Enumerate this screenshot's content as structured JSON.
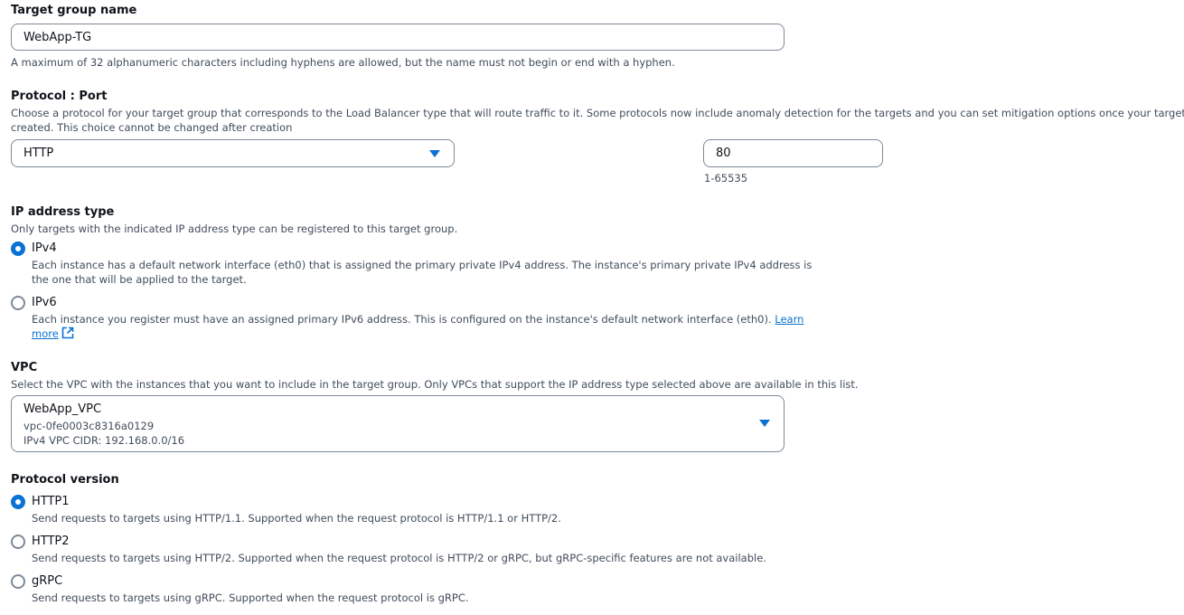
{
  "target_group_name": {
    "label": "Target group name",
    "value": "WebApp-TG",
    "hint": "A maximum of 32 alphanumeric characters including hyphens are allowed, but the name must not begin or end with a hyphen."
  },
  "protocol_port": {
    "label": "Protocol : Port",
    "description_line1": "Choose a protocol for your target group that corresponds to the Load Balancer type that will route traffic to it. Some protocols now include anomaly detection for the targets and you can set mitigation options once your target group is",
    "description_line2": "created. This choice cannot be changed after creation",
    "protocol_value": "HTTP",
    "port_value": "80",
    "port_hint": "1-65535"
  },
  "ip_address_type": {
    "label": "IP address type",
    "description": "Only targets with the indicated IP address type can be registered to this target group.",
    "options": [
      {
        "label": "IPv4",
        "selected": true,
        "description_line1": "Each instance has a default network interface (eth0) that is assigned the primary private IPv4 address. The instance's primary private IPv4 address is",
        "description_line2": "the one that will be applied to the target."
      },
      {
        "label": "IPv6",
        "selected": false,
        "description_line1": "Each instance you register must have an assigned primary IPv6 address. This is configured on the instance's default network interface (eth0).",
        "link_part1": "Learn",
        "link_part2": "more"
      }
    ]
  },
  "vpc": {
    "label": "VPC",
    "description": "Select the VPC with the instances that you want to include in the target group. Only VPCs that support the IP address type selected above are available in this list.",
    "selected_name": "WebApp_VPC",
    "selected_id": "vpc-0fe0003c8316a0129",
    "selected_cidr": "IPv4 VPC CIDR: 192.168.0.0/16"
  },
  "protocol_version": {
    "label": "Protocol version",
    "options": [
      {
        "label": "HTTP1",
        "selected": true,
        "description": "Send requests to targets using HTTP/1.1. Supported when the request protocol is HTTP/1.1 or HTTP/2."
      },
      {
        "label": "HTTP2",
        "selected": false,
        "description": "Send requests to targets using HTTP/2. Supported when the request protocol is HTTP/2 or gRPC, but gRPC-specific features are not available."
      },
      {
        "label": "gRPC",
        "selected": false,
        "description": "Send requests to targets using gRPC. Supported when the request protocol is gRPC."
      }
    ]
  },
  "icons": {
    "dropdown": "caret-down-icon",
    "external_link": "external-link-icon"
  },
  "colors": {
    "accent": "#0972d3",
    "border": "#7d8998",
    "text": "#0f141a",
    "secondary_text": "#414d5c"
  }
}
